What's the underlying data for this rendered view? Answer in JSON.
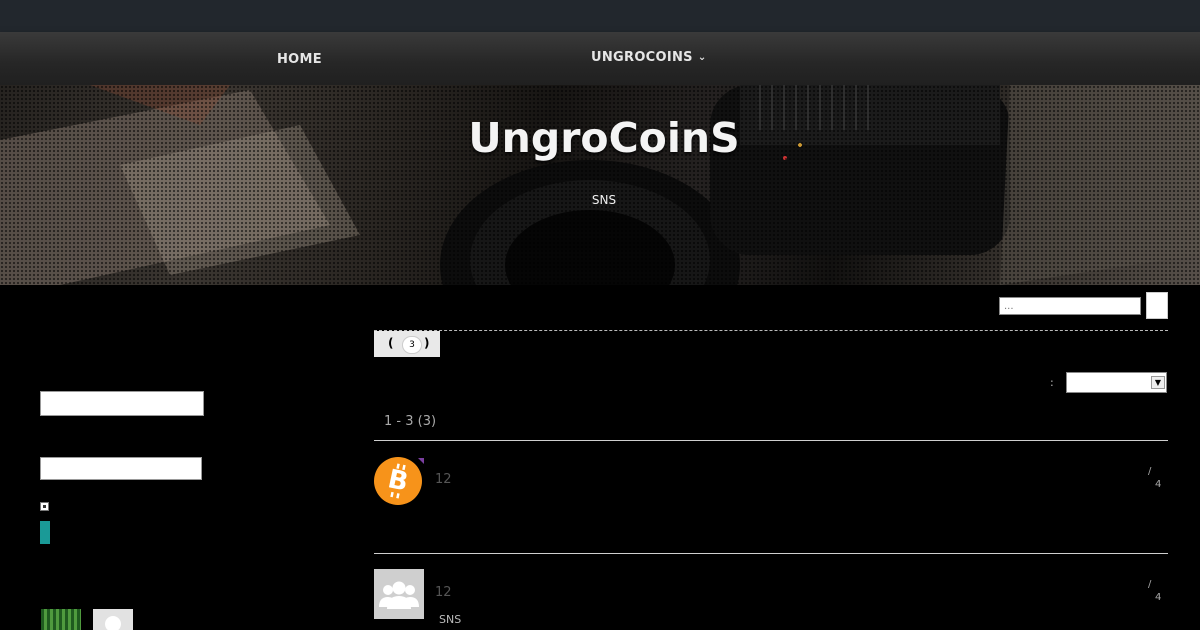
{
  "nav": {
    "home_label": "HOME",
    "coins_label": "UNGROCOINS",
    "coins_chevron": "⌄"
  },
  "hero": {
    "title": "UngroCoinS",
    "subtitle": "SNS"
  },
  "search": {
    "placeholder": "..."
  },
  "tabs": [
    {
      "open": "(",
      "count": "3",
      "close": ")"
    }
  ],
  "sort": {
    "colon": ":",
    "selected": ""
  },
  "results": {
    "summary": "1 - 3 (3)"
  },
  "items": [
    {
      "icon": "bitcoin-icon",
      "number": "12",
      "slash": "/",
      "meta": "4",
      "subtitle": ""
    },
    {
      "icon": "group-icon",
      "number": "12",
      "slash": "/",
      "meta": "4",
      "subtitle": "SNS"
    }
  ],
  "colors": {
    "topbar": "#22272d",
    "accent": "#1a9a97",
    "bitcoin": "#f7931a"
  }
}
